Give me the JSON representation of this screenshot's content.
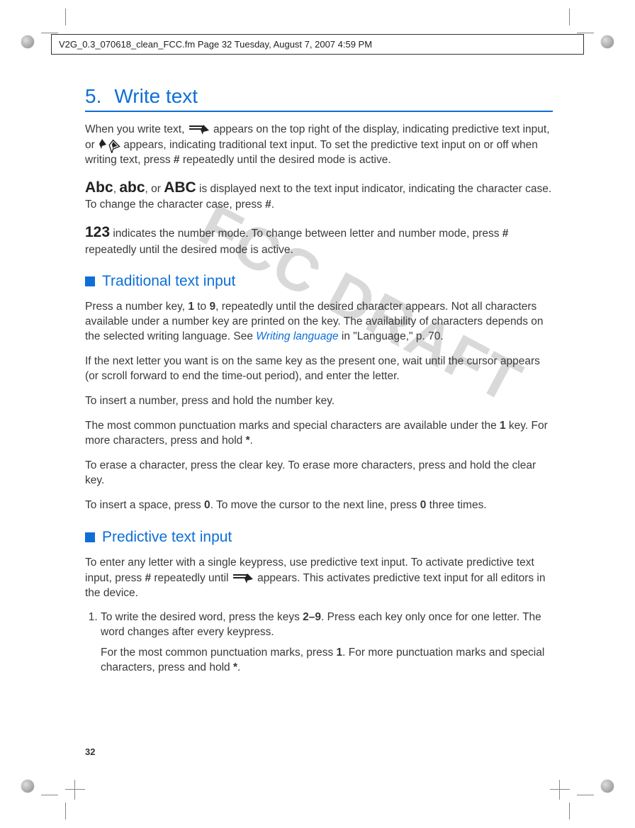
{
  "header": {
    "text": "V2G_0.3_070618_clean_FCC.fm  Page 32  Tuesday, August 7, 2007  4:59 PM"
  },
  "watermark": "FCC DRAFT",
  "title": {
    "number": "5.",
    "text": "Write text"
  },
  "intro": {
    "p1a": "When you write text, ",
    "p1b": " appears on the top right of the display, indicating predictive text input, or ",
    "p1c": " appears, indicating traditional text input. To set the predictive text input on or off when writing text, press ",
    "hash1": "#",
    "p1d": " repeatedly until the desired mode is active.",
    "case_prefix": "",
    "Abc": "Abc",
    "abc": "abc",
    "ABC": "ABC",
    "case_mid1": ", ",
    "case_mid2": ", or ",
    "case_tail": " is displayed next to the text input indicator, indicating the character case. To change the character case, press ",
    "hash2": "#",
    "case_end": ".",
    "num_prefix": "123",
    "num_tail_a": " indicates the number mode. To change between letter and number mode, press ",
    "hash3": "#",
    "num_tail_b": " repeatedly until the desired mode is active."
  },
  "trad": {
    "heading": "Traditional text input",
    "p1a": "Press a number key, ",
    "k1": "1",
    "p1b": " to ",
    "k9": "9",
    "p1c": ", repeatedly until the desired character appears. Not all characters available under a number key are printed on the key. The availability of characters depends on the selected writing language. See ",
    "linktext": "Writing language",
    "p1d": " in \"Language,\" p. 70.",
    "p2": "If the next letter you want is on the same key as the present one, wait until the cursor appears (or scroll forward to end the time-out period), and enter the letter.",
    "p3": "To insert a number, press and hold the number key.",
    "p4a": "The most common punctuation marks and special characters are available under the ",
    "k1b": "1",
    "p4b": " key. For more characters, press and hold ",
    "star": "*",
    "p4c": ".",
    "p5": "To erase a character, press the clear key. To erase more characters, press and hold the clear key.",
    "p6a": "To insert a space, press ",
    "k0a": "0",
    "p6b": ". To move the cursor to the next line, press ",
    "k0b": "0",
    "p6c": " three times."
  },
  "pred": {
    "heading": "Predictive text input",
    "p1a": "To enter any letter with a single keypress, use predictive text input. To activate predictive text input, press ",
    "hash": "#",
    "p1b": " repeatedly until ",
    "p1c": " appears. This activates predictive text input for all editors in the device.",
    "li1a": "To write the desired word, press the keys ",
    "range": "2–9",
    "li1b": ". Press each key only once for one letter. The word changes after every keypress.",
    "li1sub_a": "For the most common punctuation marks, press ",
    "k1": "1",
    "li1sub_b": ". For more punctuation marks and special characters, press and hold ",
    "star": "*",
    "li1sub_c": "."
  },
  "page_number": "32"
}
